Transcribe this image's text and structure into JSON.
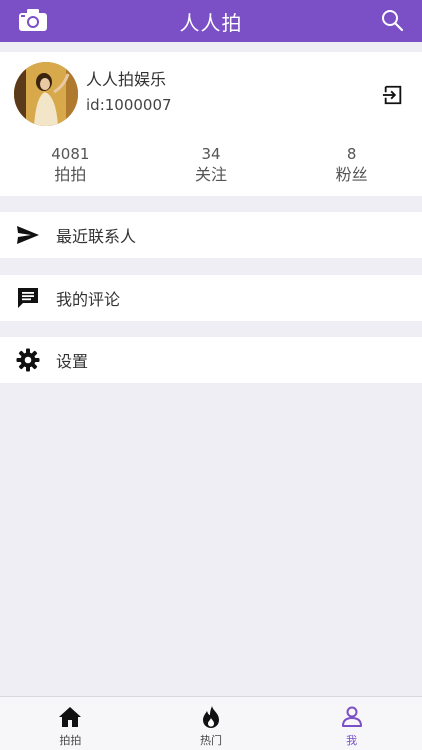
{
  "header": {
    "title": "人人拍",
    "camera_icon": "camera-icon",
    "search_icon": "search-icon"
  },
  "profile": {
    "name": "人人拍娱乐",
    "id_text": "id:1000007",
    "logout_icon": "logout-icon",
    "stats": [
      {
        "value": "4081",
        "label": "拍拍"
      },
      {
        "value": "34",
        "label": "关注"
      },
      {
        "value": "8",
        "label": "粉丝"
      }
    ]
  },
  "menu": [
    {
      "icon": "send-icon",
      "label": "最近联系人"
    },
    {
      "icon": "comment-icon",
      "label": "我的评论"
    },
    {
      "icon": "gear-icon",
      "label": "设置"
    }
  ],
  "tabbar": {
    "tabs": [
      {
        "icon": "home-icon",
        "label": "拍拍",
        "active": false
      },
      {
        "icon": "flame-icon",
        "label": "热门",
        "active": false
      },
      {
        "icon": "user-icon",
        "label": "我",
        "active": true
      }
    ]
  },
  "colors": {
    "accent": "#7b4fc6",
    "background": "#efeef4"
  }
}
